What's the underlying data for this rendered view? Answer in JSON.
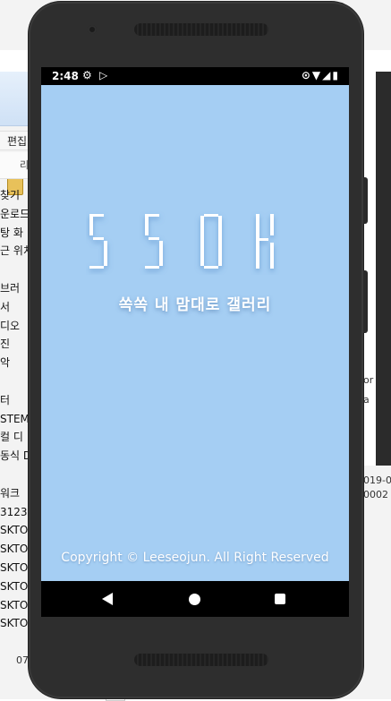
{
  "background": {
    "menu_label": "편집",
    "ribbon_label": "리",
    "nav_items": [
      "찾기",
      "운로드",
      "탕 화",
      "근 위치",
      "",
      "브러",
      "서",
      "디오",
      "진",
      "악",
      "",
      "터",
      "STEM",
      "컬 디",
      "동식 D",
      "",
      "워크",
      "3123",
      "SKTO",
      "SKTO",
      "SKTO",
      "SKTO",
      "SKTO",
      "SKTO"
    ],
    "right_texts": [
      "or",
      "a",
      "019-0",
      "0002"
    ],
    "bottom_text": "07"
  },
  "statusbar": {
    "time": "2:48",
    "left_icons": [
      "gear-icon",
      "play-store-icon"
    ],
    "right_icons": [
      "location-icon",
      "wifi-icon",
      "signal-icon",
      "battery-icon"
    ]
  },
  "app": {
    "logo_text": "SSOK",
    "subtitle": "쏙쏙 내 맘대로 갤러리",
    "copyright": "Copyright © Leeseojun. All Right Reserved",
    "background_color": "#a5cef3"
  },
  "navbar": {
    "buttons": [
      "back-icon",
      "home-icon",
      "recent-apps-icon"
    ]
  }
}
